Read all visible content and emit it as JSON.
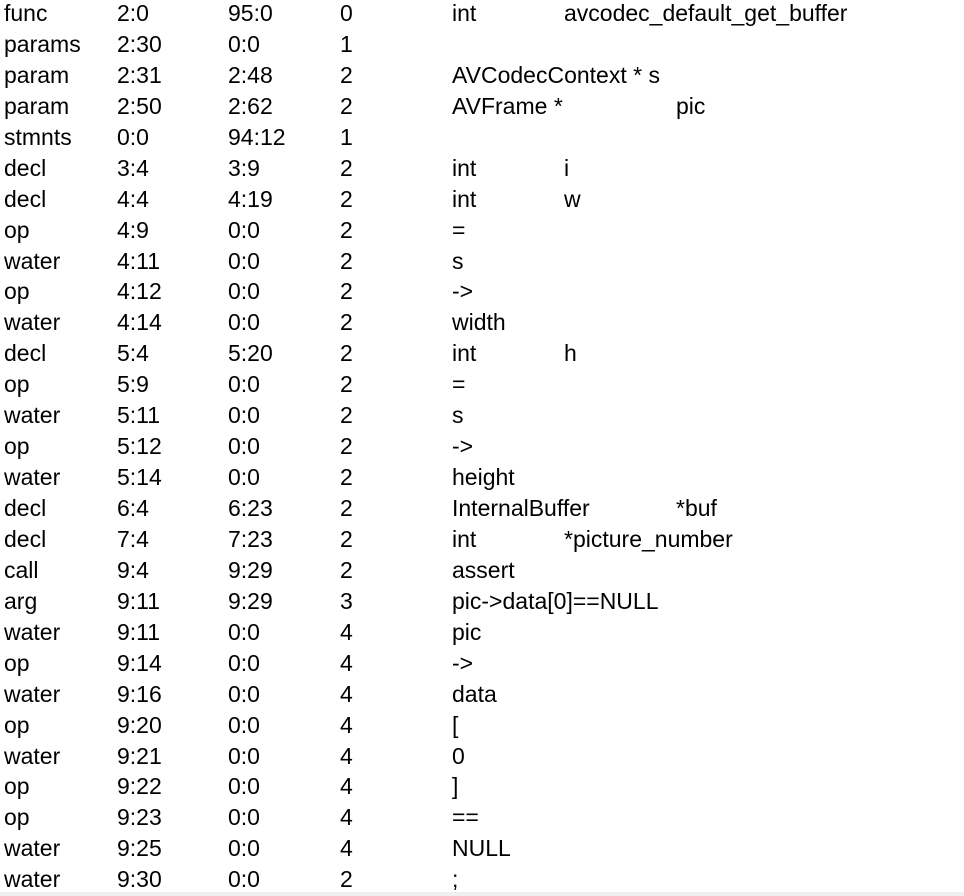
{
  "rows": [
    [
      "func",
      "2:0",
      "95:0",
      "0",
      "int\tavcodec_default_get_buffer"
    ],
    [
      "params",
      "2:30",
      "0:0",
      "1",
      ""
    ],
    [
      "param",
      "2:31",
      "2:48",
      "2",
      "AVCodecContext * s"
    ],
    [
      "param",
      "2:50",
      "2:62",
      "2",
      "AVFrame *\tpic"
    ],
    [
      "stmnts",
      "0:0",
      "94:12",
      "1",
      ""
    ],
    [
      "decl",
      "3:4",
      "3:9",
      "2",
      "int\ti"
    ],
    [
      "decl",
      "4:4",
      "4:19",
      "2",
      "int\tw"
    ],
    [
      "op",
      "4:9",
      "0:0",
      "2",
      "="
    ],
    [
      "water",
      "4:11",
      "0:0",
      "2",
      "s"
    ],
    [
      "op",
      "4:12",
      "0:0",
      "2",
      "->"
    ],
    [
      "water",
      "4:14",
      "0:0",
      "2",
      "width"
    ],
    [
      "decl",
      "5:4",
      "5:20",
      "2",
      "int\th"
    ],
    [
      "op",
      "5:9",
      "0:0",
      "2",
      "="
    ],
    [
      "water",
      "5:11",
      "0:0",
      "2",
      "s"
    ],
    [
      "op",
      "5:12",
      "0:0",
      "2",
      "->"
    ],
    [
      "water",
      "5:14",
      "0:0",
      "2",
      "height"
    ],
    [
      "decl",
      "6:4",
      "6:23",
      "2",
      "InternalBuffer\t*buf"
    ],
    [
      "decl",
      "7:4",
      "7:23",
      "2",
      "int\t*picture_number"
    ],
    [
      "call",
      "9:4",
      "9:29",
      "2",
      "assert"
    ],
    [
      "arg",
      "9:11",
      "9:29",
      "3",
      "pic->data[0]==NULL"
    ],
    [
      "water",
      "9:11",
      "0:0",
      "4",
      "pic"
    ],
    [
      "op",
      "9:14",
      "0:0",
      "4",
      "->"
    ],
    [
      "water",
      "9:16",
      "0:0",
      "4",
      "data"
    ],
    [
      "op",
      "9:20",
      "0:0",
      "4",
      "["
    ],
    [
      "water",
      "9:21",
      "0:0",
      "4",
      "0"
    ],
    [
      "op",
      "9:22",
      "0:0",
      "4",
      "]"
    ],
    [
      "op",
      "9:23",
      "0:0",
      "4",
      "=="
    ],
    [
      "water",
      "9:25",
      "0:0",
      "4",
      "NULL"
    ],
    [
      "water",
      "9:30",
      "0:0",
      "2",
      ";"
    ]
  ]
}
